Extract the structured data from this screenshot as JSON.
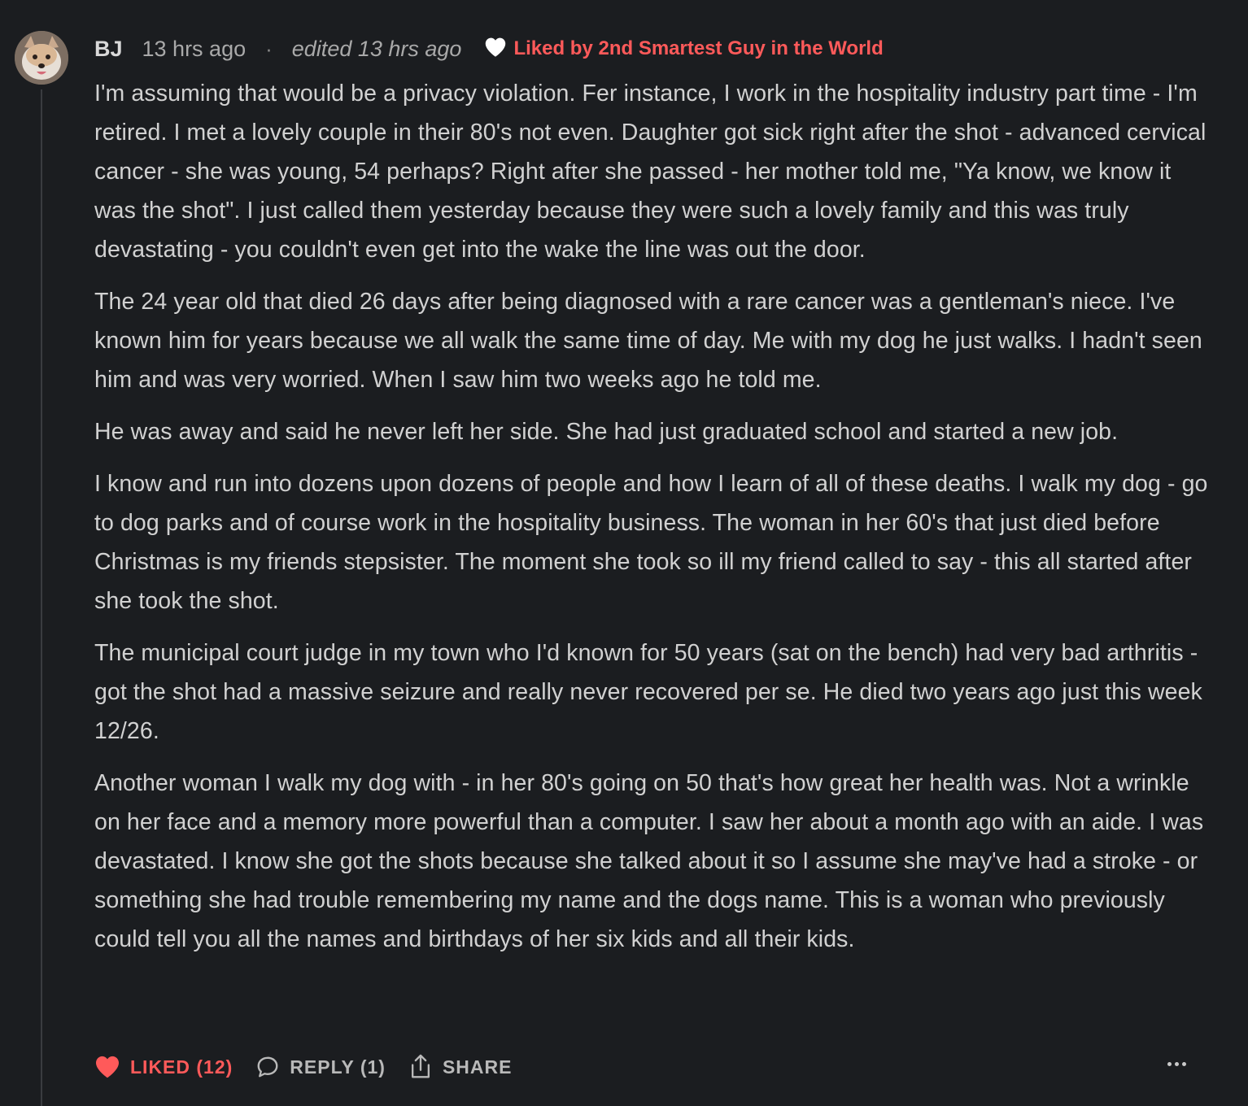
{
  "comment": {
    "author": "BJ",
    "timestamp": "13 hrs ago",
    "separator": "·",
    "edited": "edited 13 hrs ago",
    "liked_by": "Liked by 2nd Smartest Guy in the World",
    "paragraphs": [
      "I'm assuming that would be a privacy violation. Fer instance, I work in the hospitality industry part time - I'm retired. I met a lovely couple in their 80's not even. Daughter got sick right after the shot - advanced cervical cancer - she was young, 54 perhaps? Right after she passed - her mother told me, \"Ya know, we know it was the shot\". I just called them yesterday because they were such a lovely family and this was truly devastating - you couldn't even get into the wake the line was out the door.",
      "The 24 year old that died 26 days after being diagnosed with a rare cancer was a gentleman's niece. I've known him for years because we all walk the same time of day. Me with my dog he just walks. I hadn't seen him and was very worried. When I saw him two weeks ago he told me.",
      "He was away and said he never left her side. She had just graduated school and started a new job.",
      "I know and run into dozens upon dozens of people and how I learn of all of these deaths. I walk my dog - go to dog parks and of course work in the hospitality business. The woman in her 60's that just died before Christmas is my friends stepsister. The moment she took so ill my friend called to say - this all started after she took the shot.",
      "The municipal court judge in my town who I'd known for 50 years (sat on the bench) had very bad arthritis - got the shot had a massive seizure and really never recovered per se. He died two years ago just this week 12/26.",
      "Another woman I walk my dog with - in her 80's going on 50 that's how great her health was. Not a wrinkle on her face and a memory more powerful than a computer. I saw her about a month ago with an aide. I was devastated. I know she got the shots because she talked about it so I assume she may've had a stroke - or something she had trouble remembering my name and the dogs name. This is a woman who previously could tell you all the names and birthdays of her six kids and all their kids."
    ]
  },
  "actions": {
    "like_label": "LIKED (12)",
    "reply_label": "REPLY (1)",
    "share_label": "SHARE"
  },
  "colors": {
    "background": "#1b1d20",
    "accent_red": "#ff5a5a",
    "text": "#d1d1d1",
    "muted": "#a9a9a9"
  },
  "icons": {
    "avatar": "dog-avatar",
    "liked_by": "heart-outline-white-icon",
    "like": "heart-filled-icon",
    "reply": "speech-bubble-icon",
    "share": "share-icon",
    "more": "ellipsis-icon"
  }
}
